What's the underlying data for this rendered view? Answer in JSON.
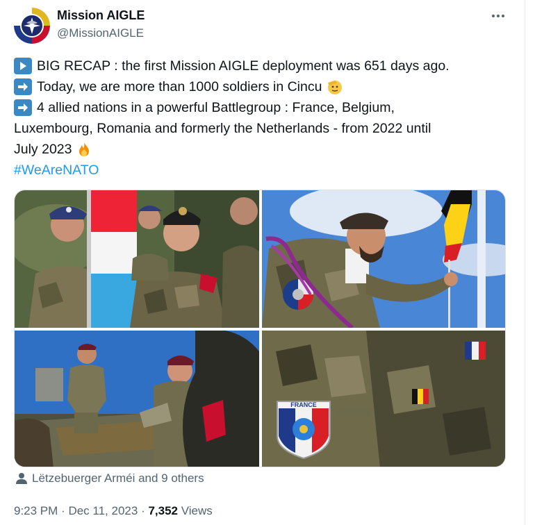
{
  "tweet": {
    "author_name": "Mission AIGLE",
    "author_handle": "@MissionAIGLE",
    "lines": [
      "BIG RECAP : the first Mission AIGLE deployment was 651 days ago.",
      "Today, we are more than 1000 soldiers in Cincu",
      "4 allied nations in a powerful Battlegroup : France, Belgium,",
      "Luxembourg, Romania and formerly the Netherlands - from 2022 until",
      "July 2023"
    ],
    "hashtag": "#WeAreNATO",
    "photo_text": "FRANCE",
    "liked_by": "Lëtzebuerger Arméi and 9 others",
    "time": "9:23 PM",
    "date": "Dec 11, 2023",
    "views_count": "7,352",
    "views_label": "Views",
    "sep": "·"
  },
  "icons": {
    "more": "more-options-icon",
    "line1": "play-button-emoji",
    "line2": "right-arrow-emoji",
    "line3": "right-arrow-emoji",
    "salute": "saluting-face-emoji",
    "fire": "fire-emoji",
    "person": "person-icon"
  },
  "colors": {
    "link": "#1d9bf0",
    "secondary": "#536471",
    "emoji_square": "#3b88c3"
  }
}
